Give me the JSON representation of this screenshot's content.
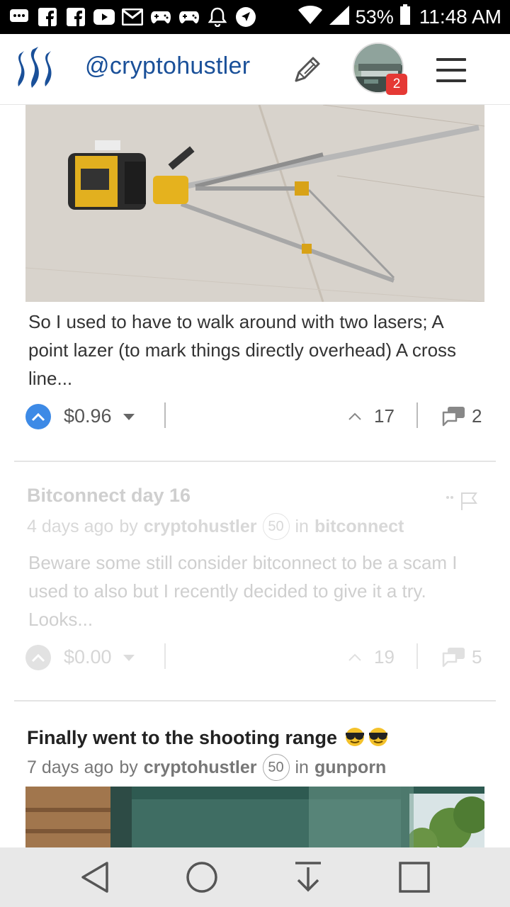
{
  "status_bar": {
    "battery_percent": "53%",
    "time": "11:48 AM",
    "icons": [
      "chat-icon",
      "facebook-icon",
      "facebook-icon",
      "youtube-icon",
      "gmail-icon",
      "game-controller-icon",
      "game-controller-icon",
      "bell-icon",
      "navigation-icon",
      "wifi-icon",
      "signal-icon",
      "battery-icon"
    ]
  },
  "header": {
    "username": "@cryptohustler",
    "notification_count": "2",
    "icons": [
      "steemit-logo",
      "edit-icon",
      "avatar",
      "menu-icon"
    ]
  },
  "posts": [
    {
      "excerpt": "So I used to have to walk around with two lasers; A point lazer (to mark things directly overhead) A cross line...",
      "payout": "$0.96",
      "votes": "17",
      "comments": "2"
    },
    {
      "title": "Bitconnect day 16",
      "time_ago": "4 days ago",
      "by_label": "by",
      "author": "cryptohustler",
      "reputation": "50",
      "in_label": "in",
      "category": "bitconnect",
      "excerpt": "Beware some still consider bitconnect to be a scam I used to also but I recently decided to give it a try. Looks...",
      "payout": "$0.00",
      "votes": "19",
      "comments": "5"
    },
    {
      "title": "Finally went to the shooting range",
      "time_ago": "7 days ago",
      "by_label": "by",
      "author": "cryptohustler",
      "reputation": "50",
      "in_label": "in",
      "category": "gunporn"
    }
  ],
  "colors": {
    "accent": "#1a5099",
    "upvote": "#3d8ae6",
    "badge": "#e53935"
  }
}
